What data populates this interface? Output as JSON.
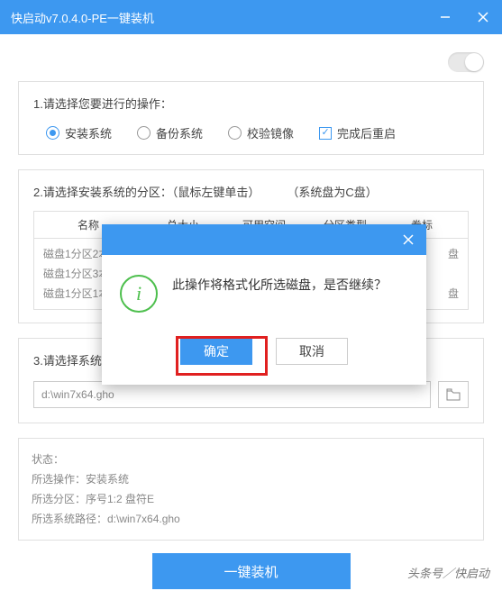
{
  "titlebar": {
    "title": "快启动v7.0.4.0-PE一键装机"
  },
  "section1": {
    "heading": "1.请选择您要进行的操作：",
    "opts": [
      "安装系统",
      "备份系统",
      "校验镜像",
      "完成后重启"
    ]
  },
  "section2": {
    "heading": "2.请选择安装系统的分区：（鼠标左键单击）",
    "note": "（系统盘为C盘）",
    "cols": [
      "名称",
      "总大小",
      "可用空间",
      "分区类型",
      "卷标"
    ],
    "rows": [
      {
        "name": "磁盘1分区2本",
        "vol": "盘"
      },
      {
        "name": "磁盘1分区3本",
        "vol": ""
      },
      {
        "name": "磁盘1分区1本",
        "vol": "盘"
      }
    ]
  },
  "section3": {
    "heading": "3.请选择系统镜",
    "path": "d:\\win7x64.gho"
  },
  "status": {
    "l1": "状态：",
    "l2": "所选操作：安装系统",
    "l3": "所选分区：序号1:2   盘符E",
    "l4": "所选系统路径：d:\\win7x64.gho"
  },
  "mainBtn": "一键装机",
  "watermark": "头条号／快启动",
  "modal": {
    "text": "此操作将格式化所选磁盘，是否继续？",
    "ok": "确定",
    "cancel": "取消"
  }
}
